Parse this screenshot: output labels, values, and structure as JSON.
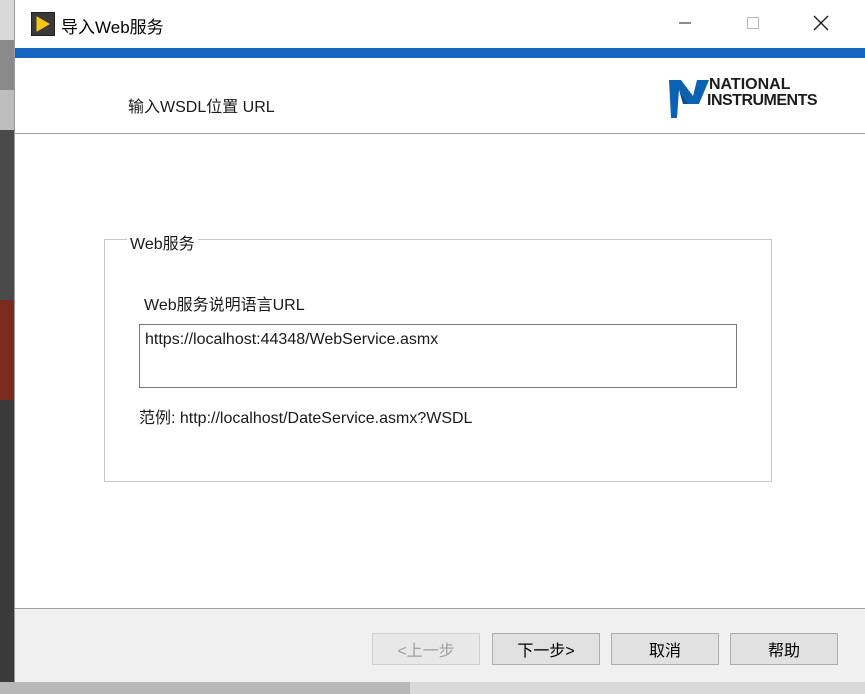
{
  "window": {
    "title": "导入Web服务",
    "icon": "labview-run-icon",
    "controls": [
      "minimize-icon",
      "maximize-icon",
      "close-icon"
    ]
  },
  "header": {
    "heading": "输入WSDL位置 URL",
    "logo_line1": "NATIONAL",
    "logo_line2": "INSTRUMENTS"
  },
  "group": {
    "legend": "Web服务",
    "field_label": "Web服务说明语言URL",
    "url_value": "https://localhost:44348/WebService.asmx",
    "example": "范例: http://localhost/DateService.asmx?WSDL"
  },
  "footer": {
    "back_label": "<上一步",
    "next_label": "下一步>",
    "cancel_label": "取消",
    "help_label": "帮助"
  },
  "colors": {
    "accent": "#1565c0",
    "footer_bg": "#f0f0f0"
  }
}
